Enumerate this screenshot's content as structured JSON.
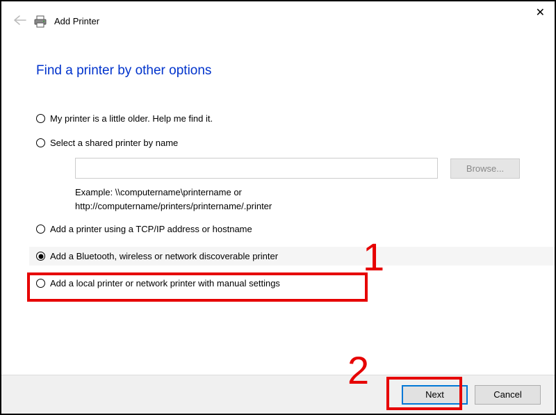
{
  "header": {
    "title": "Add Printer"
  },
  "heading": "Find a printer by other options",
  "options": {
    "opt1": "My printer is a little older. Help me find it.",
    "opt2": "Select a shared printer by name",
    "opt3": "Add a printer using a TCP/IP address or hostname",
    "opt4": "Add a Bluetooth, wireless or network discoverable printer",
    "opt5": "Add a local printer or network printer with manual settings"
  },
  "input": {
    "value": "",
    "browse": "Browse..."
  },
  "example": {
    "line1": "Example: \\\\computername\\printername or",
    "line2": "http://computername/printers/printername/.printer"
  },
  "footer": {
    "next": "Next",
    "cancel": "Cancel"
  },
  "annotations": {
    "one": "1",
    "two": "2"
  }
}
